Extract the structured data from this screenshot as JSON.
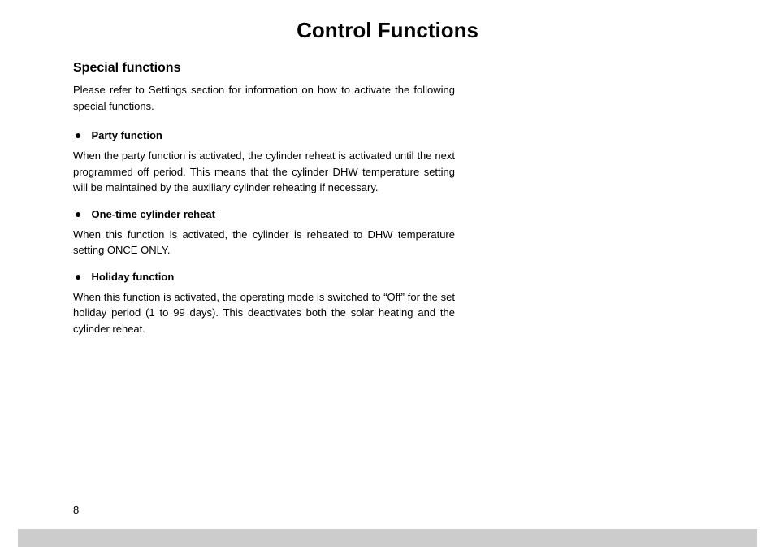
{
  "title": "Control Functions",
  "section_heading": "Special functions",
  "intro": "Please refer to Settings section for information on how to activate the following special functions.",
  "items": [
    {
      "label": "Party function",
      "body": "When the party function is activated, the cylinder reheat is activated until the next programmed off period. This means that the cylinder DHW temperature setting will be maintained by the auxiliary cylinder reheating if necessary."
    },
    {
      "label": "One-time cylinder reheat",
      "body": "When this function is activated, the cylinder is reheated to DHW temperature setting ONCE ONLY."
    },
    {
      "label": "Holiday function",
      "body": "When this function is activated, the operating mode is switched to “Off” for the set holiday period (1 to 99 days). This deactivates both the solar heating and the cylinder reheat."
    }
  ],
  "page_number": "8"
}
